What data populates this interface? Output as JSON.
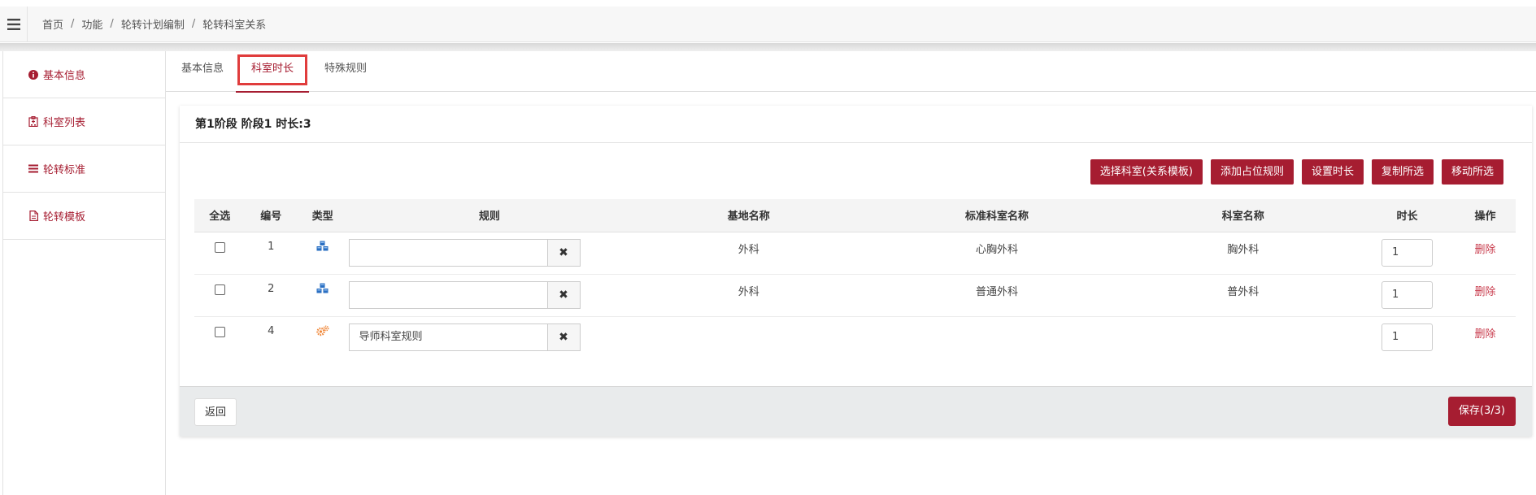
{
  "breadcrumb": [
    {
      "label": "首页"
    },
    {
      "label": "功能"
    },
    {
      "label": "轮转计划编制"
    },
    {
      "label": "轮转科室关系"
    }
  ],
  "sidebar": {
    "items": [
      {
        "label": "基本信息",
        "icon": "info-circle-icon"
      },
      {
        "label": "科室列表",
        "icon": "hospital-icon"
      },
      {
        "label": "轮转标准",
        "icon": "list-icon"
      },
      {
        "label": "轮转模板",
        "icon": "document-icon"
      }
    ]
  },
  "tabs": [
    {
      "label": "基本信息"
    },
    {
      "label": "科室时长",
      "active": true
    },
    {
      "label": "特殊规则"
    }
  ],
  "panel": {
    "title": "第1阶段 阶段1 时长:3"
  },
  "toolbar": {
    "select_dept": "选择科室(关系模板)",
    "add_rule": "添加占位规则",
    "set_duration": "设置时长",
    "copy_selected": "复制所选",
    "move_selected": "移动所选"
  },
  "table": {
    "headers": {
      "select_all": "全选",
      "number": "编号",
      "type": "类型",
      "rule": "规则",
      "base_name": "基地名称",
      "std_dept": "标准科室名称",
      "dept": "科室名称",
      "duration": "时长",
      "action": "操作"
    },
    "rows": [
      {
        "number": "1",
        "type_icon": "cubes-icon",
        "rule": "",
        "base_name": "外科",
        "std_dept": "心胸外科",
        "dept": "胸外科",
        "duration": "1",
        "action": "删除"
      },
      {
        "number": "2",
        "type_icon": "cubes-icon",
        "rule": "",
        "base_name": "外科",
        "std_dept": "普通外科",
        "dept": "普外科",
        "duration": "1",
        "action": "删除"
      },
      {
        "number": "4",
        "type_icon": "gears-icon",
        "rule": "导师科室规则",
        "base_name": "",
        "std_dept": "",
        "dept": "",
        "duration": "1",
        "action": "删除"
      }
    ]
  },
  "footer": {
    "back": "返回",
    "save": "保存(3/3)"
  },
  "colors": {
    "accent": "#a61d31",
    "highlight_border": "#e03c3c",
    "cubes_icon": "#2a6fc2",
    "gears_icon": "#f0883a"
  }
}
